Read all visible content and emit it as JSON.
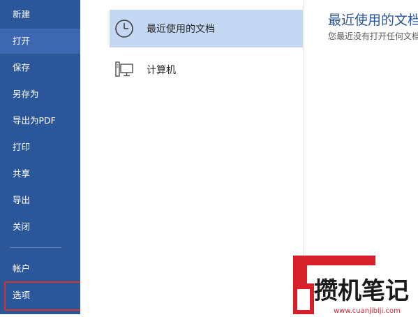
{
  "sidebar": {
    "items": [
      {
        "label": "新建"
      },
      {
        "label": "打开"
      },
      {
        "label": "保存"
      },
      {
        "label": "另存为"
      },
      {
        "label": "导出为PDF"
      },
      {
        "label": "打印"
      },
      {
        "label": "共享"
      },
      {
        "label": "导出"
      },
      {
        "label": "关闭"
      },
      {
        "label": "帐户"
      },
      {
        "label": "选项"
      }
    ],
    "active_item": "打开",
    "highlighted_item": "选项"
  },
  "locations": [
    {
      "label": "最近使用的文档",
      "icon": "clock-icon",
      "selected": true
    },
    {
      "label": "计算机",
      "icon": "computer-icon",
      "selected": false
    }
  ],
  "recent_panel": {
    "title": "最近使用的文档",
    "message": "您最近没有打开任何文档。"
  },
  "watermark": {
    "text": "攒机笔记",
    "url": "www.cuanjibiji.com"
  },
  "colors": {
    "sidebar_bg": "#2b579a",
    "sidebar_active": "#3d67b0",
    "selected_location": "#c5d8f3",
    "title_blue": "#2b579a",
    "highlight_red": "#d9342b"
  }
}
